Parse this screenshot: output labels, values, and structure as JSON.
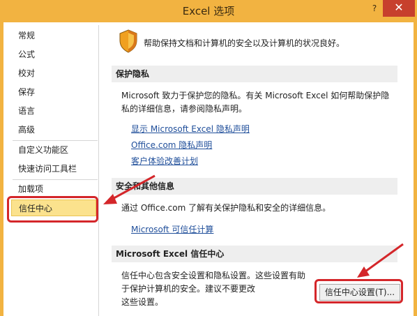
{
  "window": {
    "title": "Excel 选项",
    "help_label": "?",
    "close_label": "✕"
  },
  "sidebar": {
    "items": [
      {
        "label": "常规"
      },
      {
        "label": "公式"
      },
      {
        "label": "校对"
      },
      {
        "label": "保存"
      },
      {
        "label": "语言"
      },
      {
        "label": "高级"
      },
      {
        "label": "自定义功能区"
      },
      {
        "label": "快速访问工具栏"
      },
      {
        "label": "加载项"
      },
      {
        "label": "信任中心",
        "selected": true
      }
    ]
  },
  "content": {
    "intro": "帮助保持文档和计算机的安全以及计算机的状况良好。",
    "privacy": {
      "header": "保护隐私",
      "para_line1": "Microsoft 致力于保护您的隐私。有关 Microsoft Excel 如何帮助保护隐",
      "para_line2": "私的详细信息，请参阅隐私声明。",
      "links": [
        "显示 Microsoft Excel 隐私声明",
        "Office.com 隐私声明",
        "客户体验改善计划"
      ]
    },
    "security": {
      "header": "安全和其他信息",
      "para": "通过 Office.com 了解有关保护隐私和安全的详细信息。",
      "link": "Microsoft 可信任计算"
    },
    "trust_center": {
      "header": "Microsoft Excel 信任中心",
      "para_line1": "信任中心包含安全设置和隐私设置。这些设置有助",
      "para_line2": "于保护计算机的安全。建议不要更改",
      "para_line3": "这些设置。",
      "button_label": "信任中心设置(T)..."
    }
  },
  "colors": {
    "title_bar": "#f2b341",
    "close_button": "#c7402d",
    "selected_item": "#fbe28d",
    "link": "#1f4e9a",
    "annotation": "#d4262a"
  }
}
